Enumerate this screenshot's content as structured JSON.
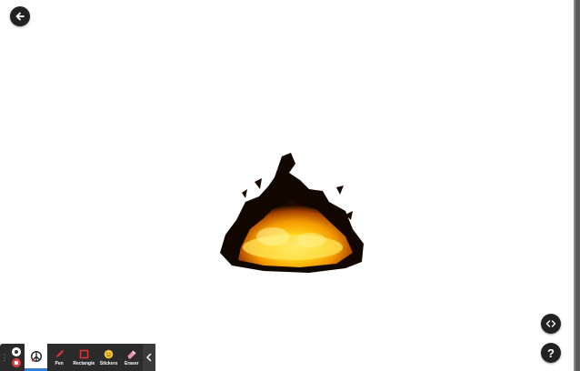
{
  "toolbar": {
    "tools": [
      {
        "label": "Pen"
      },
      {
        "label": "Rectangle"
      },
      {
        "label": "Stickers"
      },
      {
        "label": "Eraser"
      }
    ]
  },
  "help": {
    "label": "?"
  },
  "icons": [
    "back-arrow-icon",
    "code-icon",
    "help-icon",
    "drag-handle-icon",
    "record-icon",
    "stop-icon",
    "peace-sign-icon",
    "pen-icon",
    "rectangle-icon",
    "sticker-icon",
    "eraser-icon",
    "chevron-left-icon"
  ],
  "colors": {
    "accent": "#2f7fd8",
    "toolbar": "#2b2b2b",
    "pen": "#e03535",
    "sticker": "#f2c12e",
    "eraser": "#f08fb0"
  }
}
